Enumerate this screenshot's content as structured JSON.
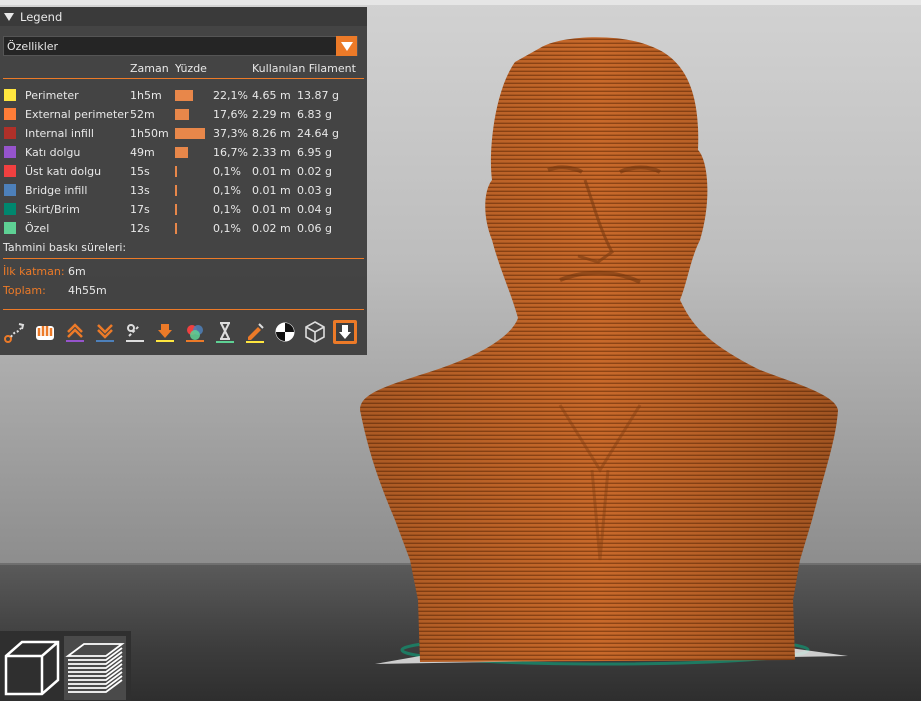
{
  "legend": {
    "title": "Legend",
    "view_type": "Özellikler",
    "columns": {
      "time": "Zaman",
      "percent": "Yüzde",
      "filament": "Kullanılan Filament"
    },
    "rows": [
      {
        "name": "Perimeter",
        "time": "1h5m",
        "percent": "22,1%",
        "percent_value": 22.1,
        "length": "4.65 m",
        "weight": "13.87 g",
        "color": "#ffe63f"
      },
      {
        "name": "External perimeter",
        "time": "52m",
        "percent": "17,6%",
        "percent_value": 17.6,
        "length": "2.29 m",
        "weight": "6.83 g",
        "color": "#ff7d38"
      },
      {
        "name": "Internal infill",
        "time": "1h50m",
        "percent": "37,3%",
        "percent_value": 37.3,
        "length": "8.26 m",
        "weight": "24.64 g",
        "color": "#b03029"
      },
      {
        "name": "Katı dolgu",
        "time": "49m",
        "percent": "16,7%",
        "percent_value": 16.7,
        "length": "2.33 m",
        "weight": "6.95 g",
        "color": "#9654cc"
      },
      {
        "name": "Üst katı dolgu",
        "time": "15s",
        "percent": "0,1%",
        "percent_value": 0.1,
        "length": "0.01 m",
        "weight": "0.02 g",
        "color": "#f04040"
      },
      {
        "name": "Bridge infill",
        "time": "13s",
        "percent": "0,1%",
        "percent_value": 0.1,
        "length": "0.01 m",
        "weight": "0.03 g",
        "color": "#4d80ba"
      },
      {
        "name": "Skirt/Brim",
        "time": "17s",
        "percent": "0,1%",
        "percent_value": 0.1,
        "length": "0.01 m",
        "weight": "0.04 g",
        "color": "#00876e"
      },
      {
        "name": "Özel",
        "time": "12s",
        "percent": "0,1%",
        "percent_value": 0.1,
        "length": "0.02 m",
        "weight": "0.06 g",
        "color": "#5ed194"
      }
    ],
    "estimate_label": "Tahmini baskı süreleri:",
    "first_layer_label": "İlk katman:",
    "first_layer_value": "6m",
    "total_label": "Toplam:",
    "total_value": "4h55m"
  },
  "toolbar": {
    "icons": [
      "travel-icon",
      "wipe-icon",
      "retractions-icon",
      "deretractions-icon",
      "seams-icon",
      "tool-changes-icon",
      "color-changes-icon",
      "pause-prints-icon",
      "custom-gcodes-icon",
      "center-of-gravity-icon",
      "shells-icon",
      "tool-marker-icon"
    ]
  },
  "view_buttons": [
    "3d-view-icon",
    "layers-view-icon"
  ],
  "colors": {
    "accent": "#ec7a28",
    "model": "#c8692a",
    "panel": "#3e3e3e"
  }
}
